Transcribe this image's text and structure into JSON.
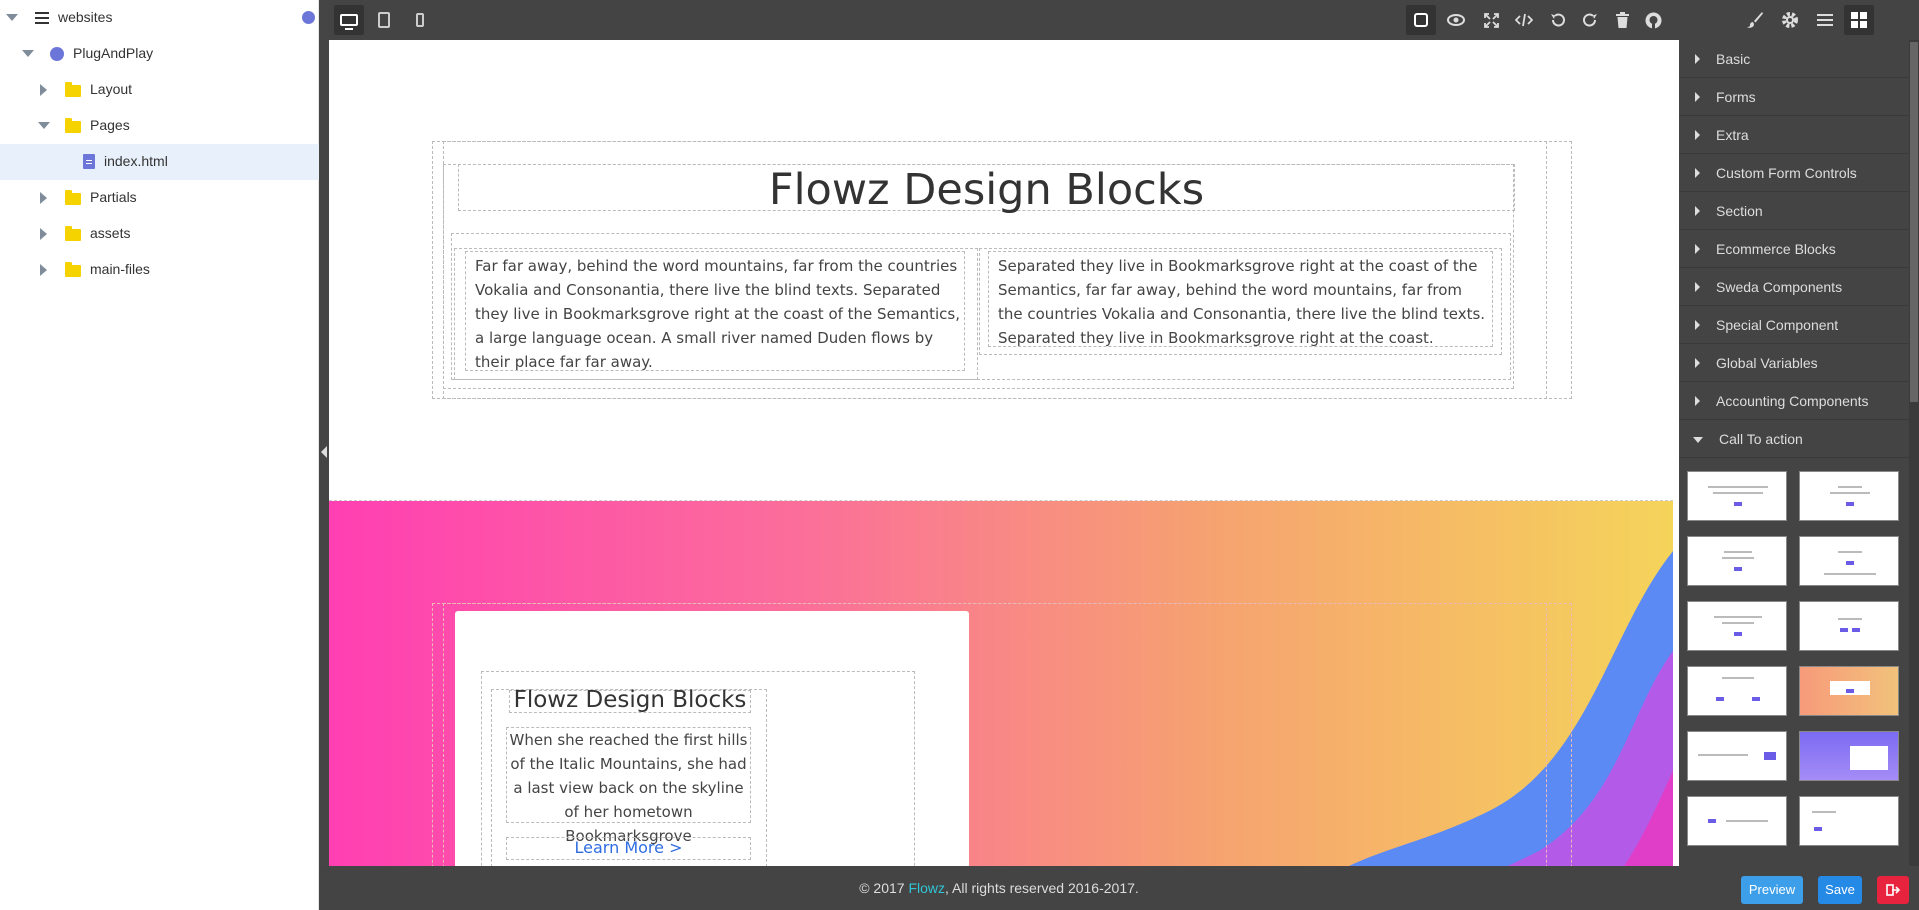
{
  "tree": {
    "root": "websites",
    "project": "PlugAndPlay",
    "folders": [
      "Layout",
      "Pages",
      "Partials",
      "assets",
      "main-files"
    ],
    "selected_file": "index.html"
  },
  "canvas": {
    "section1": {
      "heading": "Flowz Design Blocks",
      "para_left": "Far far away, behind the word mountains, far from the countries Vokalia and Consonantia, there live the blind texts. Separated they live in Bookmarksgrove right at the coast of the Semantics, a large language ocean. A small river named Duden flows by their place far far away.",
      "para_right": "Separated they live in Bookmarksgrove right at the coast of the Semantics, far far away, behind the word mountains, far from the countries Vokalia and Consonantia, there live the blind texts. Separated they live in Bookmarksgrove right at the coast."
    },
    "section2": {
      "card_title": "Flowz Design Blocks",
      "card_text": "When she reached the first hills of the Italic Mountains, she had a last view back on the skyline of her hometown Bookmarksgrove",
      "card_link": "Learn More >"
    }
  },
  "footer": {
    "copy_prefix": "© 2017 ",
    "brand": "Flowz",
    "copy_suffix": ", All rights reserved 2016-2017.",
    "preview_label": "Preview",
    "save_label": "Save"
  },
  "blocks_panel": {
    "categories": [
      "Basic",
      "Forms",
      "Extra",
      "Custom Form Controls",
      "Section",
      "Ecommerce Blocks",
      "Sweda Components",
      "Special Component",
      "Global Variables",
      "Accounting Components",
      "Call To action"
    ],
    "open_category": "Call To action"
  },
  "colors": {
    "toolbar": "#444444",
    "accent_blue": "#2589e6",
    "exit_red": "#e8233e",
    "brand_teal": "#2fc6d8",
    "folder_yellow": "#f5d300"
  }
}
